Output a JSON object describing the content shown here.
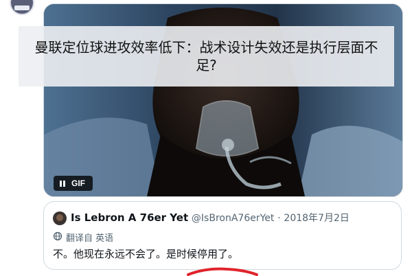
{
  "media": {
    "overlay_title": "曼联定位球进攻效率低下：战术设计失效还是执行层面不足?",
    "gif_label": "GIF"
  },
  "quote": {
    "author_name": "Is Lebron A 76er Yet",
    "author_handle": "@IsBronA76erYet",
    "separator": "·",
    "date": "2018年7月2日",
    "translate_label": "翻译自 英语",
    "text": "不。他现在永远不会了。是时候停用了。"
  },
  "icons": {
    "pause": "pause-icon",
    "translate": "globe-translate-icon"
  },
  "colors": {
    "secondary_text": "#536471",
    "border": "#cfd9de",
    "annotation_red": "#e0242b"
  }
}
